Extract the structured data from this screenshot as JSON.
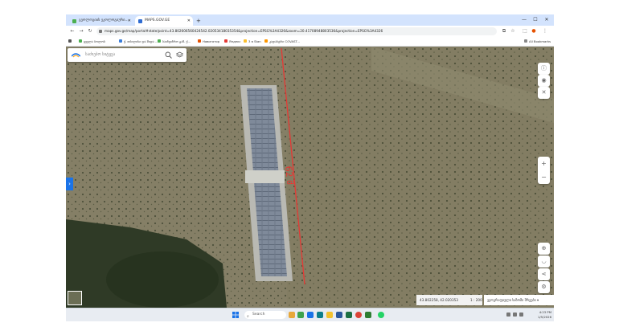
{
  "browser": {
    "tabs": [
      {
        "label": "გეოლოგიის ეკოლოგიური...",
        "favicon_color": "#4caf50"
      },
      {
        "label": "MAPS.GOV.GE",
        "favicon_color": "#2e6bd1"
      }
    ],
    "new_tab": "+",
    "controls": {
      "minimize": "—",
      "maximize": "☐",
      "close": "✕"
    },
    "nav": {
      "back": "←",
      "forward": "→",
      "reload": "↻"
    },
    "address": "maps.gov.ge/map/portal#state/point=43.802606560424542.02053418035354&projection=EPSG%3A4326&zoom=20.41708948803536&projection=EPSG%3A4326",
    "address_icons": {
      "cast": "⧉",
      "star": "☆",
      "ext": "⬚",
      "download": "⤓",
      "avatar": "●",
      "menu": "⋮"
    },
    "bookmarks": [
      {
        "label": "ყველა ბოლოს",
        "color": "#4caf50"
      },
      {
        "label": "ქ. თბილისი და შიდა ...",
        "color": "#3b7dd8"
      },
      {
        "label": "საინჟინრო გამ. ქ...",
        "color": "#4caf50"
      },
      {
        "label": "Навигатор",
        "color": "#e65100"
      },
      {
        "label": "Яндекс",
        "color": "#e53935"
      },
      {
        "label": "3 в Stan",
        "color": "#fbc02d"
      },
      {
        "label": "კადასტრი COVAST...",
        "color": "#ff9800"
      }
    ],
    "all_bookmarks": "All Bookmarks"
  },
  "map": {
    "search_placeholder": "საძიებო სიტყვა",
    "measurement_label": "62 მ",
    "measurement_color": "#e53935",
    "coordinates": "43.802258, 42.020353",
    "scale": "1 : 200",
    "layer_selector": "ვეოგრაფიული საზომი შრეები ▾",
    "side_tab": "›",
    "right_controls": {
      "info": "ⓘ",
      "layers": "◉",
      "tools": "✕",
      "zoom_in": "+",
      "zoom_out": "−",
      "locate": "⊕",
      "measure": "◡",
      "share": "⋖",
      "settings": "⚙"
    }
  },
  "taskbar": {
    "search": "Search",
    "time": "4:23 PM",
    "date": "1/5/2026"
  }
}
